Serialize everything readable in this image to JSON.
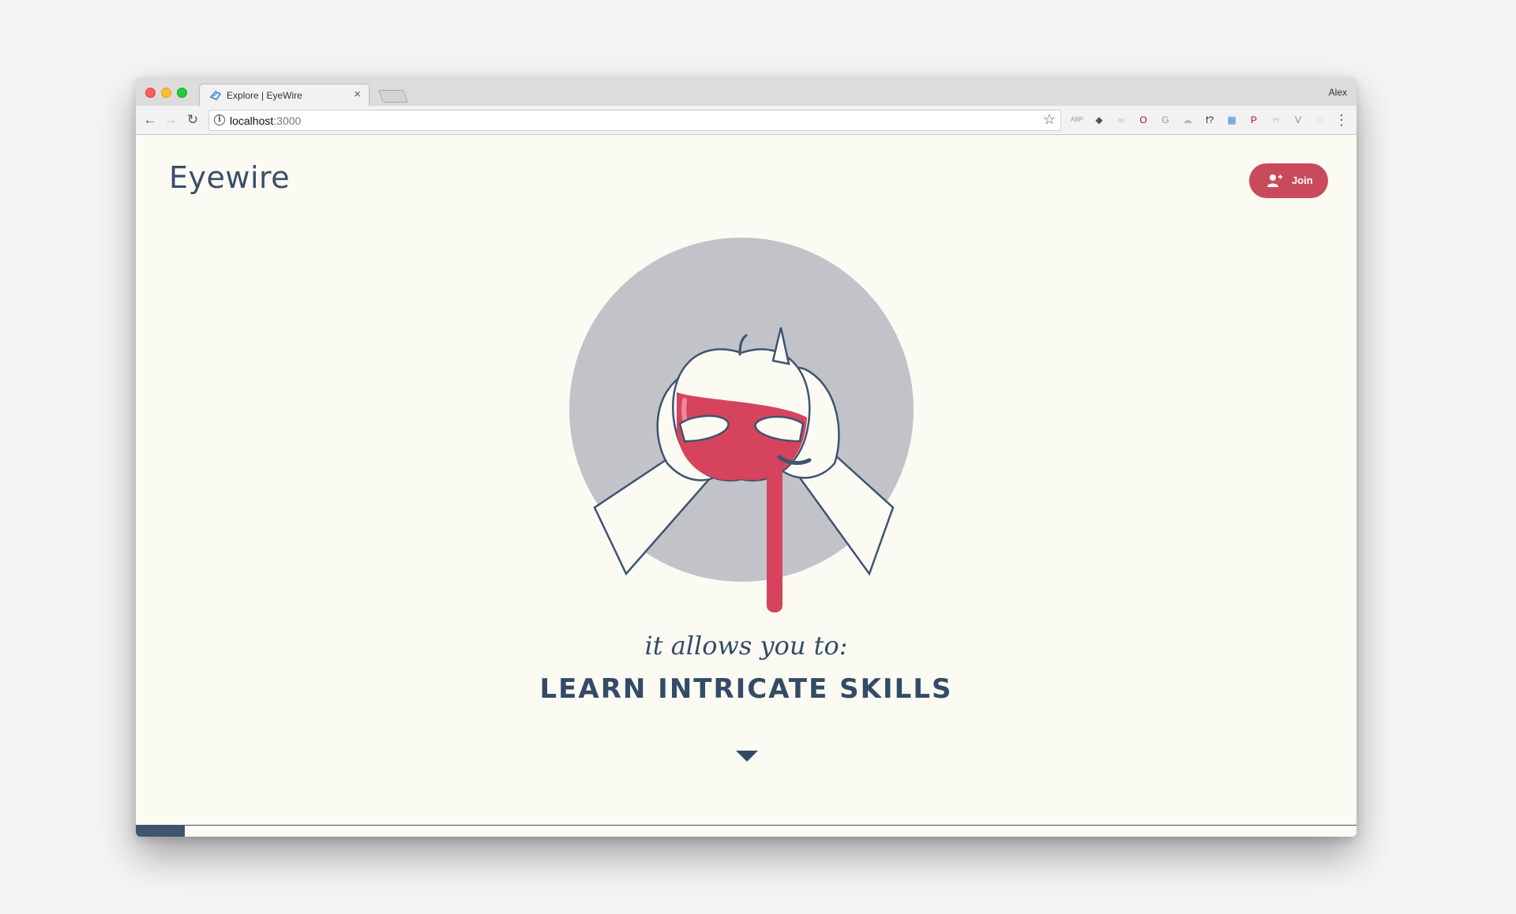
{
  "browser": {
    "tab_title": "Explore | EyeWire",
    "tab_close": "×",
    "profile_name": "Alex",
    "url_host": "localhost",
    "url_port": ":3000",
    "nav": {
      "back_icon": "←",
      "forward_icon": "→",
      "reload_icon": "↻"
    },
    "extensions": [
      {
        "name": "abp-icon",
        "glyph": "ABP",
        "color": "#9a9a9a"
      },
      {
        "name": "pocket-icon",
        "glyph": "◆",
        "color": "#555555"
      },
      {
        "name": "link-icon",
        "glyph": "∞",
        "color": "#bbbbbb"
      },
      {
        "name": "opera-icon",
        "glyph": "O",
        "color": "#d0021b"
      },
      {
        "name": "grammarly-icon",
        "glyph": "G",
        "color": "#9a9a9a"
      },
      {
        "name": "cloud-icon",
        "glyph": "☁",
        "color": "#bbbbbb"
      },
      {
        "name": "font-icon",
        "glyph": "f?",
        "color": "#333333"
      },
      {
        "name": "calendar-icon",
        "glyph": "▦",
        "color": "#3b82d6"
      },
      {
        "name": "pinterest-icon",
        "glyph": "P",
        "color": "#d0021b"
      },
      {
        "name": "broadcast-icon",
        "glyph": "(•)",
        "color": "#aaaaaa"
      },
      {
        "name": "vue-icon",
        "glyph": "V",
        "color": "#888888"
      },
      {
        "name": "chat-icon",
        "glyph": "◌",
        "color": "#aaaaaa"
      }
    ]
  },
  "site": {
    "logo": "Eyewire",
    "join_label": "Join",
    "subtitle": "it allows you to:",
    "headline": "LEARN INTRICATE SKILLS",
    "progress_fraction": 0.04
  },
  "colors": {
    "accent": "#c94b5b",
    "navy": "#344b66",
    "page_bg": "#fbfbf3",
    "circle": "#c2c3c9",
    "apple_red": "#d6435c"
  }
}
